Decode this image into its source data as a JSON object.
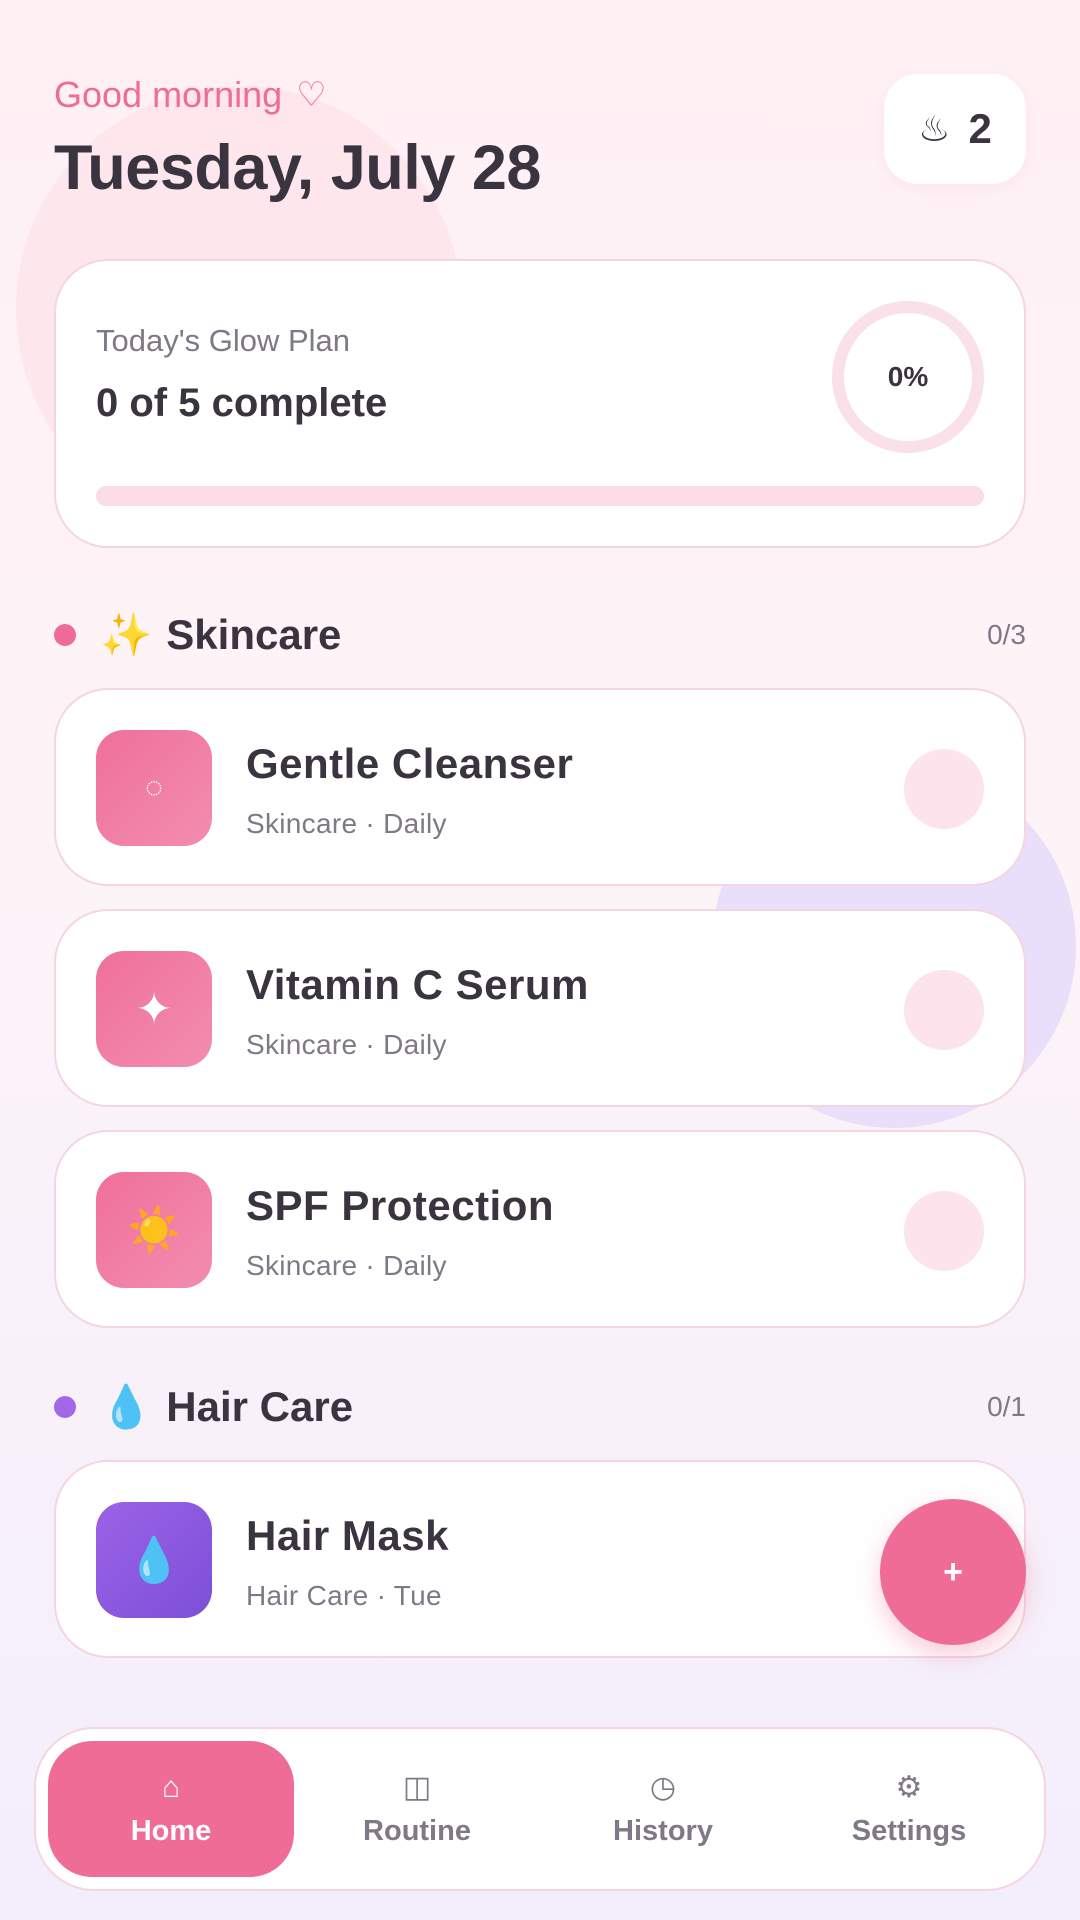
{
  "header": {
    "greeting": "Good morning",
    "greeting_icon": "heart-outline-icon",
    "heart_glyph": "♡",
    "date": "Tuesday, July 28",
    "streak": {
      "icon": "steam-icon",
      "glyph": "♨",
      "count": "2"
    }
  },
  "plan": {
    "title": "Today's Glow Plan",
    "summary": "0 of 5 complete",
    "percent_label": "0%",
    "progress": 0
  },
  "sections": [
    {
      "emoji": "✨",
      "name": "Skincare",
      "progress": "0/3",
      "dot_color": "#ee6c96",
      "items": [
        {
          "name": "Gentle Cleanser",
          "meta": "Skincare · Daily",
          "icon": "bubble-icon",
          "glyph": "◌",
          "completed": false
        },
        {
          "name": "Vitamin C Serum",
          "meta": "Skincare · Daily",
          "icon": "sparkle-icon",
          "glyph": "✦",
          "completed": false
        },
        {
          "name": "SPF Protection",
          "meta": "Skincare · Daily",
          "icon": "sun-icon",
          "glyph": "☀️",
          "completed": false
        }
      ]
    },
    {
      "emoji": "💧",
      "name": "Hair Care",
      "progress": "0/1",
      "dot_color": "#a368e8",
      "items": [
        {
          "name": "Hair Mask",
          "meta": "Hair Care · Tue",
          "icon": "droplet-icon",
          "glyph": "💧",
          "completed": false
        }
      ]
    }
  ],
  "fab": {
    "label": "+"
  },
  "nav": [
    {
      "label": "Home",
      "icon": "home-icon",
      "glyph": "⌂",
      "active": true
    },
    {
      "label": "Routine",
      "icon": "routine-icon",
      "glyph": "◫",
      "active": false
    },
    {
      "label": "History",
      "icon": "clock-icon",
      "glyph": "◷",
      "active": false
    },
    {
      "label": "Settings",
      "icon": "gear-icon",
      "glyph": "⚙",
      "active": false
    }
  ],
  "colors": {
    "accent": "#ee6c96",
    "lilac": "#a368e8",
    "text": "#3a3340",
    "muted": "#7f7886"
  }
}
